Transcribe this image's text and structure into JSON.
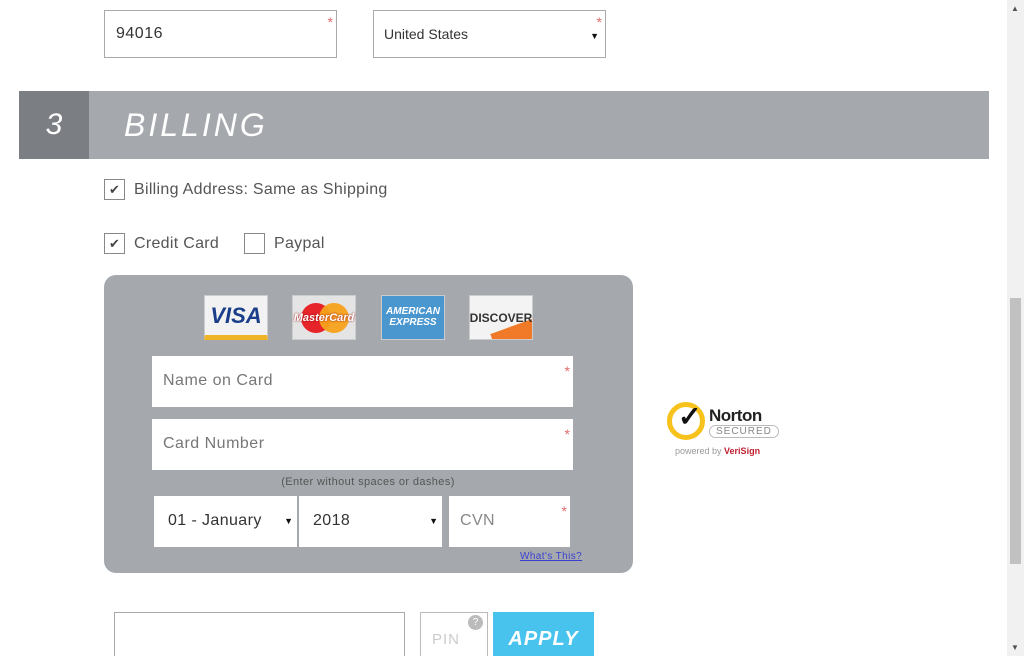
{
  "address": {
    "zip_value": "94016",
    "country_value": "United States",
    "required_mark": "*"
  },
  "section": {
    "number": "3",
    "title": "BILLING"
  },
  "options": {
    "same_as_shipping_label": "Billing Address: Same as Shipping",
    "same_as_shipping_checked": true,
    "credit_card_label": "Credit Card",
    "credit_card_checked": true,
    "paypal_label": "Paypal",
    "paypal_checked": false,
    "check_glyph": "✔"
  },
  "card": {
    "logos": {
      "visa": "VISA",
      "mastercard": "MasterCard",
      "amex_line1": "AMERICAN",
      "amex_line2": "EXPRESS",
      "discover": "DISCOVER"
    },
    "name_placeholder": "Name on Card",
    "number_placeholder": "Card Number",
    "number_hint": "(Enter without spaces or dashes)",
    "month_value": "01 - January",
    "year_value": "2018",
    "cvn_placeholder": "CVN",
    "whats_this": "What's This?"
  },
  "norton": {
    "name": "Norton",
    "secured": "SECURED",
    "powered_by": "powered by",
    "verisign": "VeriSign",
    "tm": "™"
  },
  "promo": {
    "pin_placeholder": "PIN",
    "help_glyph": "?",
    "apply_label": "APPLY"
  },
  "colors": {
    "header_bg": "#a5a9ad",
    "header_num_bg": "#7b7e82",
    "apply_bg": "#47c3ee",
    "required": "#e06a6a",
    "link": "#3a3fd0"
  },
  "icons": {
    "caret": "▼",
    "scroll_up": "▲",
    "scroll_down": "▼"
  }
}
